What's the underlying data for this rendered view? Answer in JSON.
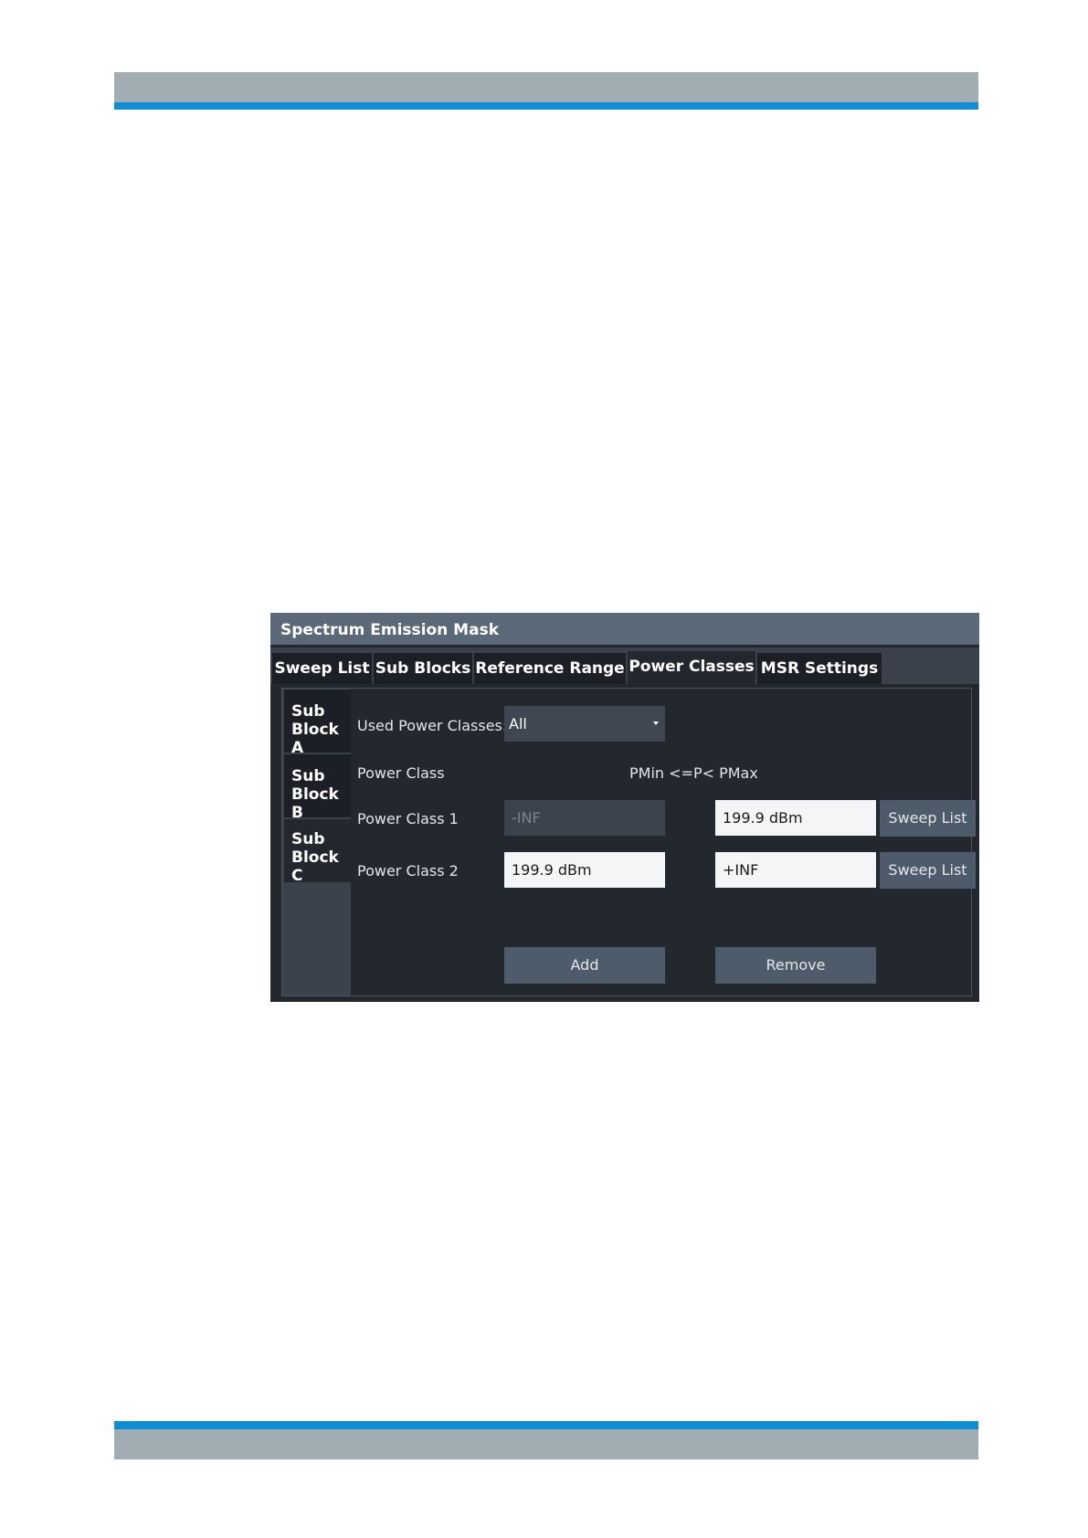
{
  "dialog": {
    "title": "Spectrum Emission Mask",
    "tabs": [
      {
        "label": "Sweep List"
      },
      {
        "label": "Sub Blocks"
      },
      {
        "label": "Reference Range"
      },
      {
        "label": "Power Classes",
        "active": true
      },
      {
        "label": "MSR Settings"
      }
    ],
    "sub_blocks": [
      {
        "line1": "Sub",
        "line2": "Block A"
      },
      {
        "line1": "Sub",
        "line2": "Block B"
      },
      {
        "line1": "Sub",
        "line2": "Block C",
        "active": true
      }
    ],
    "used_power_classes": {
      "label": "Used Power Classes:",
      "value": "All"
    },
    "headers": {
      "power_class": "Power Class",
      "range": "PMin <=P< PMax"
    },
    "rows": [
      {
        "label": "Power Class 1",
        "pmin": "-INF",
        "pmin_disabled": true,
        "pmax": "199.9 dBm",
        "sweep_list_label": "Sweep List"
      },
      {
        "label": "Power Class 2",
        "pmin": "199.9 dBm",
        "pmin_disabled": false,
        "pmax": "+INF",
        "sweep_list_label": "Sweep List"
      }
    ],
    "add_label": "Add",
    "remove_label": "Remove"
  },
  "colors": {
    "accent": "#0d8fd7",
    "header_bar": "#a2adb3",
    "dialog_bg": "#23272e",
    "titlebar": "#5a6877",
    "button": "#4d5b6a"
  }
}
